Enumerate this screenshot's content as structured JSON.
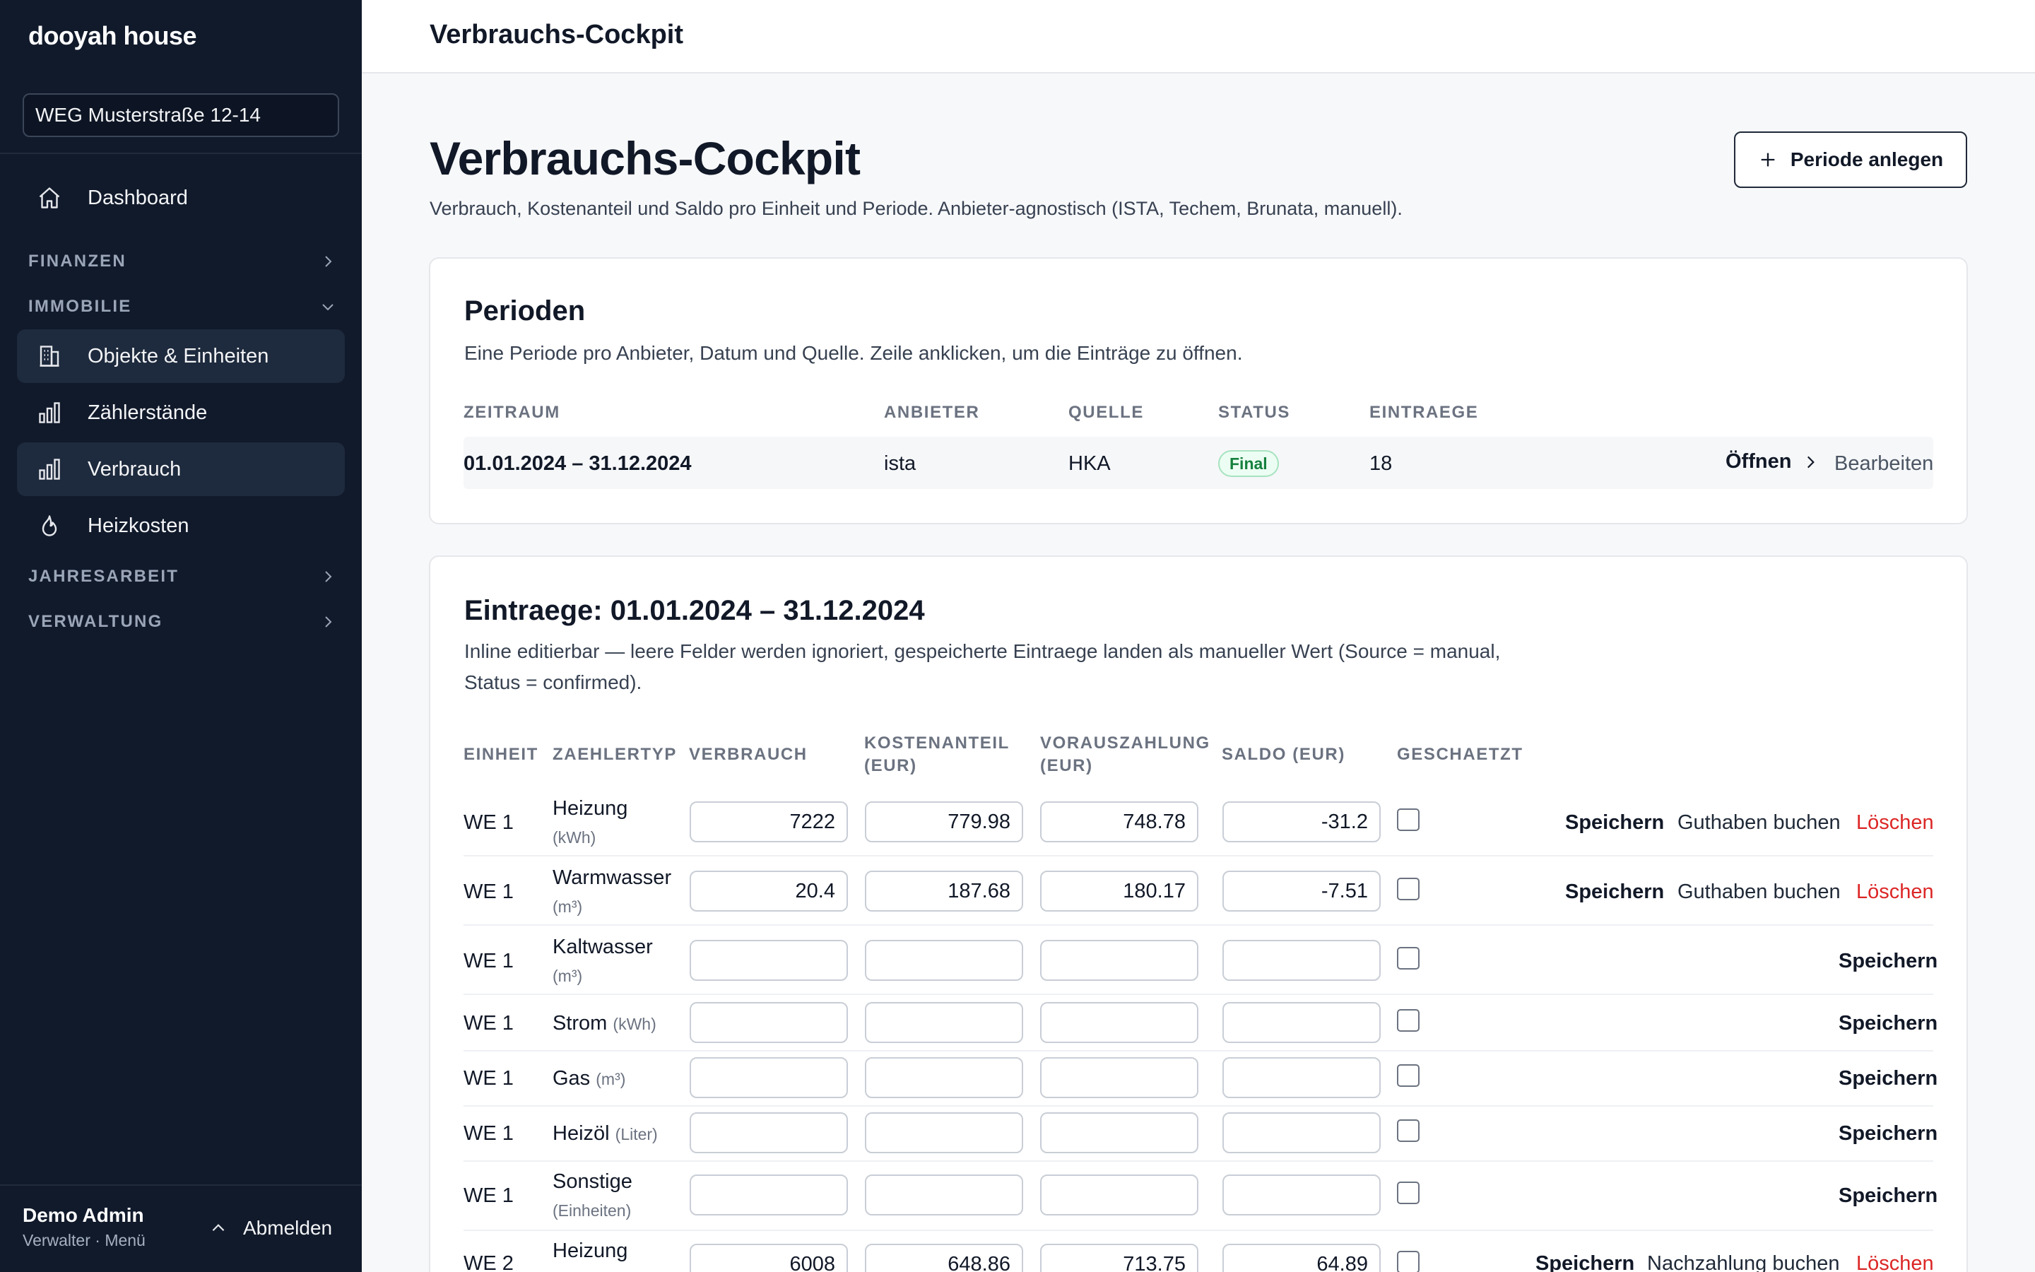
{
  "sidebar": {
    "brand": "dooyah house",
    "org": "WEG Musterstraße 12-14",
    "dashboard": "Dashboard",
    "sections": {
      "finanzen": "FINANZEN",
      "immobilie": "IMMOBILIE",
      "jahresarbeit": "JAHRESARBEIT",
      "verwaltung": "VERWALTUNG"
    },
    "items": {
      "objekte": "Objekte & Einheiten",
      "zaehler": "Zählerstände",
      "verbrauch": "Verbrauch",
      "heizkosten": "Heizkosten"
    },
    "user": {
      "name": "Demo Admin",
      "role": "Verwalter · Menü",
      "logout": "Abmelden"
    }
  },
  "topbar": {
    "title": "Verbrauchs-Cockpit"
  },
  "page": {
    "title": "Verbrauchs-Cockpit",
    "subtitle": "Verbrauch, Kostenanteil und Saldo pro Einheit und Periode. Anbieter-agnostisch (ISTA, Techem, Brunata, manuell).",
    "new_period": "Periode anlegen"
  },
  "periods": {
    "title": "Perioden",
    "subtitle": "Eine Periode pro Anbieter, Datum und Quelle. Zeile anklicken, um die Einträge zu öffnen.",
    "headers": {
      "zeitraum": "ZEITRAUM",
      "anbieter": "ANBIETER",
      "quelle": "QUELLE",
      "status": "STATUS",
      "eintraege": "EINTRAEGE"
    },
    "row": {
      "zeitraum": "01.01.2024 – 31.12.2024",
      "anbieter": "ista",
      "quelle": "HKA",
      "status": "Final",
      "eintraege": "18",
      "open": "Öffnen",
      "edit": "Bearbeiten"
    }
  },
  "entries": {
    "title": "Eintraege: 01.01.2024 – 31.12.2024",
    "subtitle_1": "Inline editierbar — leere Felder werden ignoriert, gespeicherte Eintraege landen als manueller Wert (Source = manual,",
    "subtitle_2": "Status = confirmed).",
    "headers": {
      "einheit": "EINHEIT",
      "zaehlertyp": "ZAEHLERTYP",
      "verbrauch": "VERBRAUCH",
      "kosten_1": "KOSTENANTEIL",
      "kosten_2": "(EUR)",
      "voraus_1": "VORAUSZAHLUNG",
      "voraus_2": "(EUR)",
      "saldo": "SALDO (EUR)",
      "geschaetzt": "GESCHAETZT"
    },
    "actions": {
      "save": "Speichern",
      "credit": "Guthaben buchen",
      "payment": "Nachzahlung buchen",
      "delete": "Löschen"
    },
    "rows": [
      {
        "unit": "WE 1",
        "type": "Heizung",
        "type_unit": "(kWh)",
        "verbrauch": "7222",
        "kosten": "779.98",
        "voraus": "748.78",
        "saldo": "-31.2"
      },
      {
        "unit": "WE 1",
        "type": "Warmwasser",
        "type_unit": "(m³)",
        "verbrauch": "20.4",
        "kosten": "187.68",
        "voraus": "180.17",
        "saldo": "-7.51"
      },
      {
        "unit": "WE 1",
        "type": "Kaltwasser",
        "type_unit": "(m³)",
        "verbrauch": "",
        "kosten": "",
        "voraus": "",
        "saldo": ""
      },
      {
        "unit": "WE 1",
        "type": "Strom",
        "type_unit": "(kWh)",
        "verbrauch": "",
        "kosten": "",
        "voraus": "",
        "saldo": ""
      },
      {
        "unit": "WE 1",
        "type": "Gas",
        "type_unit": "(m³)",
        "verbrauch": "",
        "kosten": "",
        "voraus": "",
        "saldo": ""
      },
      {
        "unit": "WE 1",
        "type": "Heizöl",
        "type_unit": "(Liter)",
        "verbrauch": "",
        "kosten": "",
        "voraus": "",
        "saldo": ""
      },
      {
        "unit": "WE 1",
        "type": "Sonstige",
        "type_unit": "(Einheiten)",
        "verbrauch": "",
        "kosten": "",
        "voraus": "",
        "saldo": ""
      },
      {
        "unit": "WE 2",
        "type": "Heizung",
        "type_unit": "",
        "verbrauch": "6008",
        "kosten": "648.86",
        "voraus": "713.75",
        "saldo": "64.89"
      }
    ]
  },
  "colors": {
    "sidebar_bg": "#111a2b",
    "accent_delete": "#dc2626",
    "badge_green": "#15803d"
  }
}
